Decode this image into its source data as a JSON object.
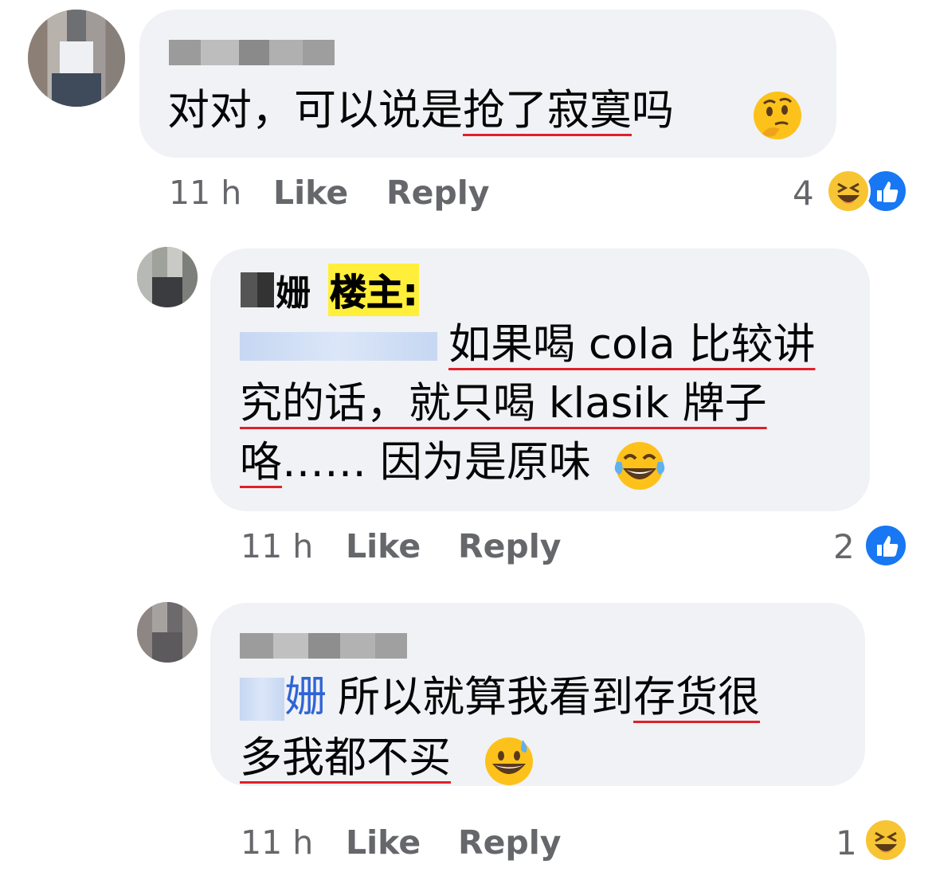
{
  "comments": [
    {
      "text_a": "对对，可以说是",
      "text_b": "抢了寂寞",
      "text_c": "吗",
      "emoji": "thinking-face",
      "time": "11 h",
      "like_label": "Like",
      "reply_label": "Reply",
      "reaction_count": "4",
      "reactions": [
        "haha",
        "like"
      ]
    },
    {
      "author_suffix": "姗",
      "op_badge": "楼主:",
      "line1_a": "如果喝 cola 比较讲",
      "line2_a": "究的话，就只喝 klasik 牌子",
      "line3_a": "咯",
      "line3_b": "…… 因为是原味",
      "emoji": "tears-of-joy-face",
      "time": "11 h",
      "like_label": "Like",
      "reply_label": "Reply",
      "reaction_count": "2",
      "reactions": [
        "like"
      ]
    },
    {
      "mention_suffix": "姗",
      "line1_a": "所以就算我看到",
      "line1_b": "存货很",
      "line2_a": "多我都不买",
      "emoji": "grinning-sweat-face",
      "time": "11 h",
      "like_label": "Like",
      "reply_label": "Reply",
      "reaction_count": "1",
      "reactions": [
        "haha"
      ]
    }
  ],
  "colors": {
    "bubble": "#f0f2f5",
    "meta_text": "#65676b",
    "like_blue": "#1877f2",
    "haha_yellow": "#f7c433",
    "underline_red": "#e0202a",
    "mention_blue": "#2f64d6",
    "op_badge_bg": "#ffef3a"
  }
}
